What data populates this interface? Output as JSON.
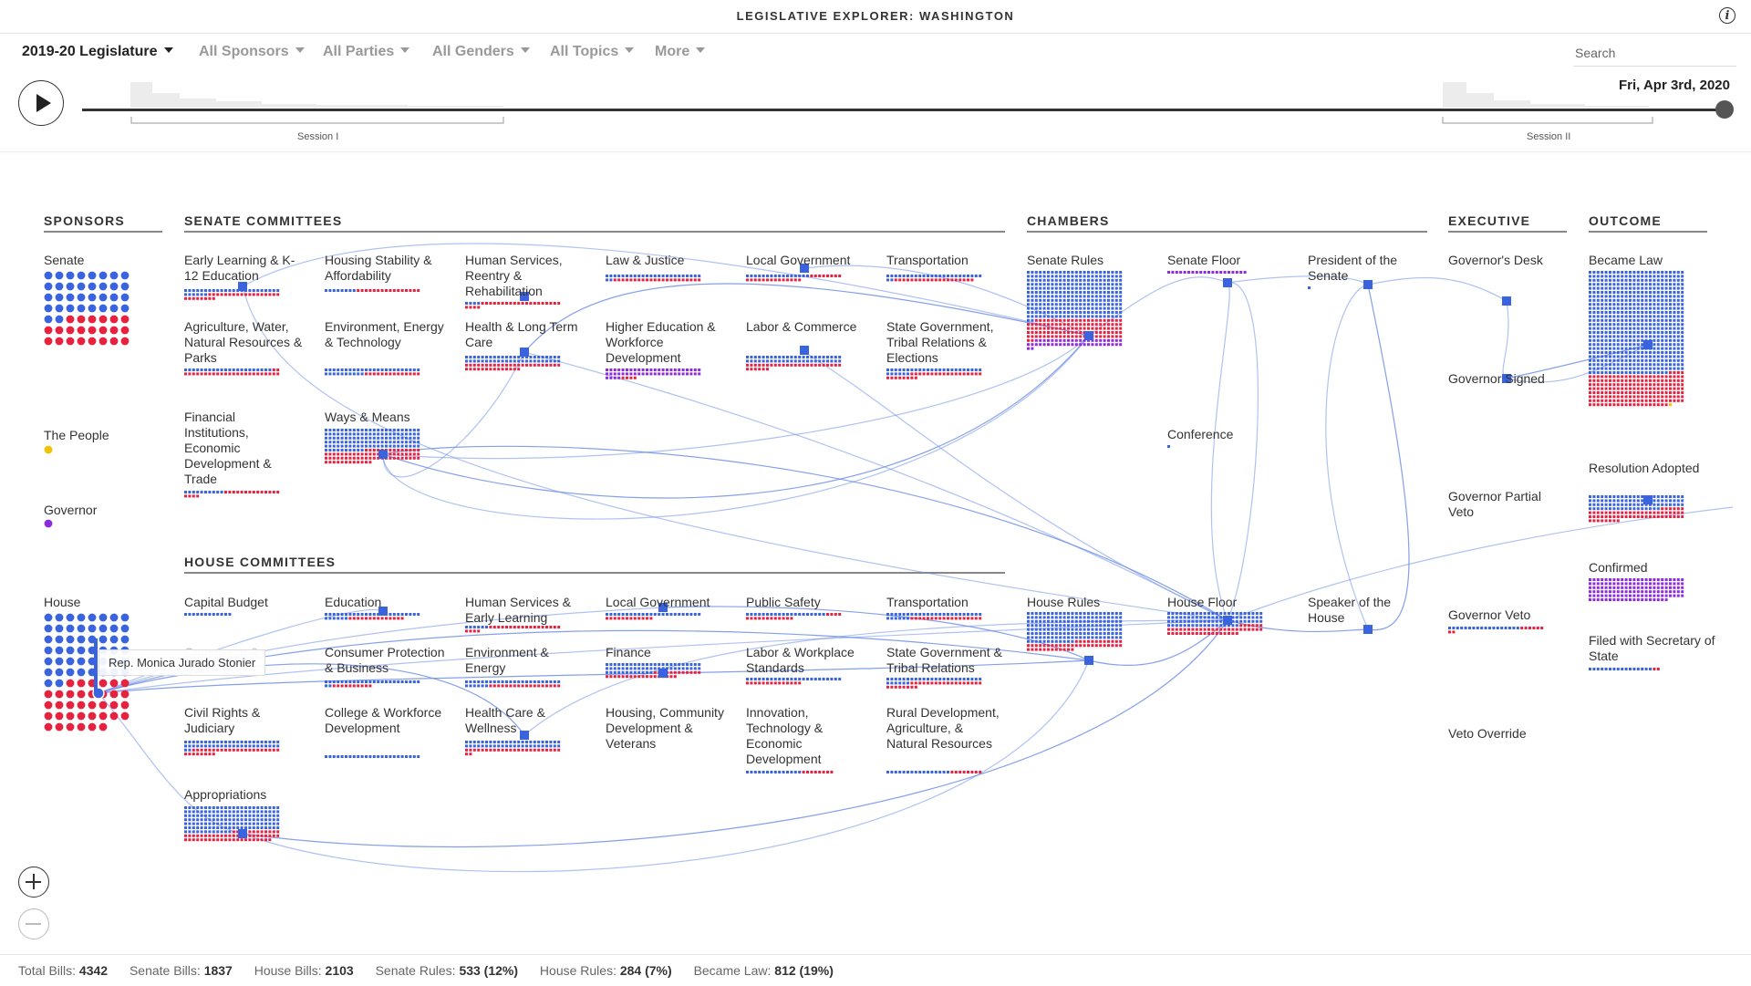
{
  "app": {
    "title": "LEGISLATIVE EXPLORER: WASHINGTON",
    "info_icon": "info-icon"
  },
  "filters": {
    "legislature": "2019-20 Legislature",
    "sponsors": "All Sponsors",
    "parties": "All Parties",
    "genders": "All Genders",
    "topics": "All Topics",
    "more": "More"
  },
  "search": {
    "placeholder": "Search"
  },
  "timeline": {
    "date": "Fri, Apr 3rd, 2020",
    "session1": "Session I",
    "session2": "Session II",
    "play_icon": "play-icon",
    "progress_fraction": 1.0
  },
  "columns": {
    "sponsors": "SPONSORS",
    "senate_committees": "SENATE COMMITTEES",
    "house_committees": "HOUSE COMMITTEES",
    "chambers": "CHAMBERS",
    "executive": "EXECUTIVE",
    "outcome": "OUTCOME"
  },
  "sponsors": {
    "senate": "Senate",
    "the_people": "The People",
    "governor": "Governor",
    "house": "House"
  },
  "senate_committees": {
    "early_learning": "Early Learning & K-12 Education",
    "housing": "Housing Stability & Affordability",
    "human_services": "Human Services, Reentry & Rehabilitation",
    "law_justice": "Law & Justice",
    "local_gov": "Local Government",
    "transportation": "Transportation",
    "agriculture": "Agriculture, Water, Natural Resources & Parks",
    "environment": "Environment, Energy & Technology",
    "health": "Health & Long Term Care",
    "higher_ed": "Higher Education & Workforce Development",
    "labor": "Labor & Commerce",
    "state_gov": "State Government, Tribal Relations & Elections",
    "financial": "Financial Institutions, Economic Development & Trade",
    "ways_means": "Ways & Means"
  },
  "house_committees": {
    "capital_budget": "Capital Budget",
    "education": "Education",
    "human_services": "Human Services & Early Learning",
    "local_gov": "Local Government",
    "public_safety": "Public Safety",
    "transportation": "Transportation",
    "commerce": "Commerce & Gaming",
    "consumer": "Consumer Protection & Business",
    "environment": "Environment & Energy",
    "finance": "Finance",
    "labor": "Labor & Workplace Standards",
    "state_gov": "State Government & Tribal Relations",
    "civil_rights": "Civil Rights & Judiciary",
    "college": "College & Workforce Development",
    "health": "Health Care & Wellness",
    "housing": "Housing, Community Development & Veterans",
    "innovation": "Innovation, Technology & Economic Development",
    "rural": "Rural Development, Agriculture, & Natural Resources",
    "appropriations": "Appropriations"
  },
  "chambers": {
    "senate_rules": "Senate Rules",
    "senate_floor": "Senate Floor",
    "president": "President of the Senate",
    "conference": "Conference",
    "house_rules": "House Rules",
    "house_floor": "House Floor",
    "speaker": "Speaker of the House"
  },
  "executive": {
    "desk": "Governor's Desk",
    "signed": "Governor Signed",
    "partial_veto": "Governor Partial Veto",
    "veto": "Governor Veto",
    "override": "Veto Override"
  },
  "outcome": {
    "became_law": "Became Law",
    "resolution": "Resolution Adopted",
    "confirmed": "Confirmed",
    "filed": "Filed with Secretary of State"
  },
  "tooltip": {
    "text": "Rep. Monica Jurado Stonier"
  },
  "zoom": {
    "in_icon": "zoom-in-icon",
    "out_icon": "zoom-out-icon"
  },
  "footer": {
    "total_label": "Total Bills:",
    "total_value": "4342",
    "senate_label": "Senate Bills:",
    "senate_value": "1837",
    "house_label": "House Bills:",
    "house_value": "2103",
    "srules_label": "Senate Rules:",
    "srules_value": "533 (12%)",
    "hrules_label": "House Rules:",
    "hrules_value": "284 (7%)",
    "law_label": "Became Law:",
    "law_value": "812 (19%)"
  },
  "colors": {
    "democrat": "#3a63e0",
    "republican": "#e8213f",
    "purple": "#8e2be0",
    "yellow": "#f2c200",
    "flow": "#6f8fe8"
  }
}
